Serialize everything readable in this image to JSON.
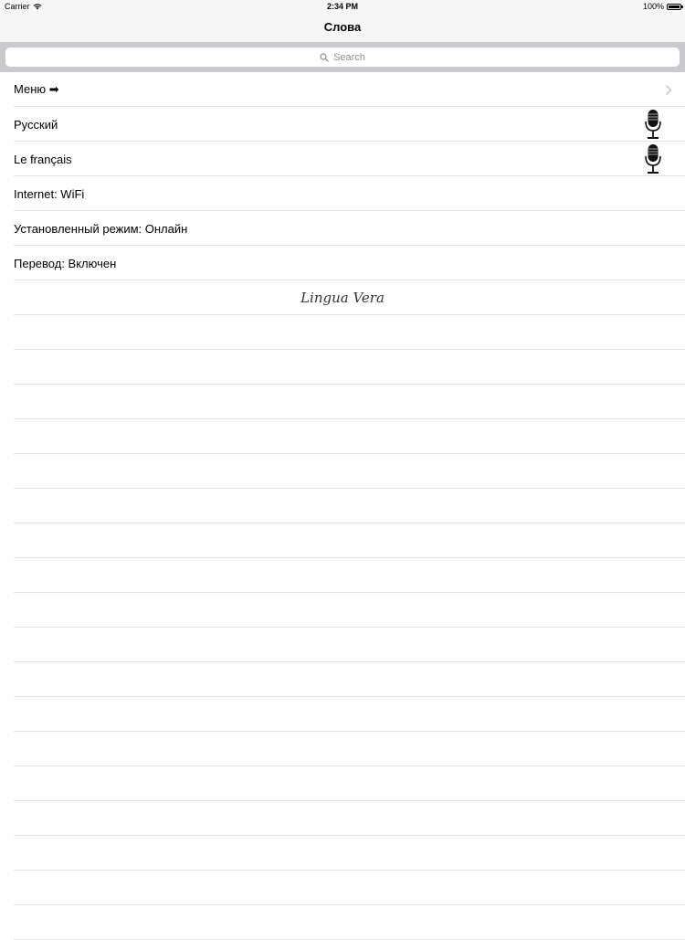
{
  "status_bar": {
    "carrier": "Carrier",
    "time": "2:34 PM",
    "battery": "100%"
  },
  "nav": {
    "title": "Слова"
  },
  "search": {
    "placeholder": "Search"
  },
  "rows": {
    "menu": "Меню ➡",
    "russian": "Русский",
    "french": "Le français",
    "internet": "Internet: WiFi",
    "mode": "Установленный режим: Онлайн",
    "translation": "Перевод: Включен"
  },
  "logo": "Lingua Vera",
  "icons": {
    "wifi": "wifi-icon",
    "battery": "battery-icon",
    "search": "search-icon",
    "chevron": "chevron-right-icon",
    "mic": "microphone-icon"
  }
}
